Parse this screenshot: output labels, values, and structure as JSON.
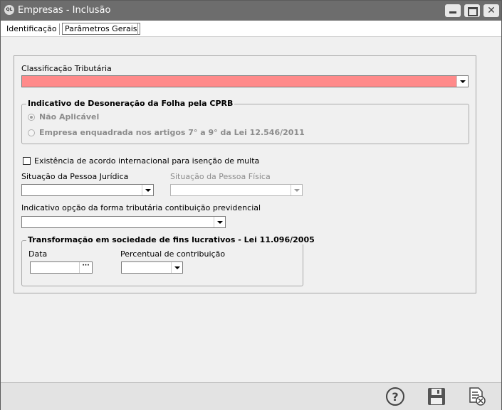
{
  "window": {
    "title": "Empresas - Inclusão",
    "app_icon_text": "QL"
  },
  "tabs": [
    {
      "label": "Identificação"
    },
    {
      "label": "Parâmetros Gerais"
    }
  ],
  "form": {
    "classificacao_label": "Classificação Tributária",
    "classificacao_value": "",
    "classificacao_color": "#ff8a8a",
    "desoneracao": {
      "title": "Indicativo de Desoneração da Folha pela CPRB",
      "options": [
        {
          "label": "Não Aplicável",
          "selected": true
        },
        {
          "label": "Empresa enquadrada nos artigos 7° a 9° da Lei 12.546/2011",
          "selected": false
        }
      ]
    },
    "acordo_label": "Existência de acordo internacional para isenção de multa",
    "acordo_checked": false,
    "pj_label": "Situação da Pessoa Jurídica",
    "pj_value": "",
    "pf_label": "Situação da Pessoa Física",
    "pf_value": "",
    "opcao_label": "Indicativo opção da forma tributária contibuição previdencial",
    "opcao_value": "",
    "transformacao": {
      "title": "Transformação em sociedade de fins lucrativos - Lei  11.096/2005",
      "data_label": "Data",
      "data_value": "",
      "data_button": "···",
      "percentual_label": "Percentual de contribuição",
      "percentual_value": ""
    }
  },
  "footer": {
    "icons": [
      "help-icon",
      "save-icon",
      "cancel-icon"
    ]
  }
}
